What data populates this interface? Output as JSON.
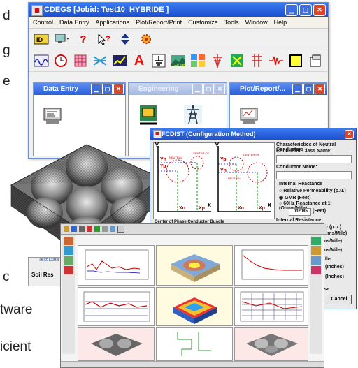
{
  "background_text": {
    "line1": "d",
    "line2": "g",
    "line3": "e",
    "line4": "c",
    "line5": "tware",
    "line6": "icient"
  },
  "main_window": {
    "title": "CDEGS [Jobid: Test10_HYBRIDE ]",
    "menu": [
      "Control",
      "Data Entry",
      "Applications",
      "Plot/Report/Print",
      "Customize",
      "Tools",
      "Window",
      "Help"
    ],
    "child_windows": {
      "data_entry": "Data Entry",
      "engineering": "Engineering",
      "plot": "Plot/Report/..."
    }
  },
  "fcdist_dialog": {
    "title": "FCDIST (Configuration Method)",
    "right_panel": {
      "heading": "Characteristics of Neutral Conductors",
      "class_name": "Conductor Class Name:",
      "conductor_name": "Conductor Name:",
      "internal_reactance": "Internal Reactance",
      "opt1": "Relative Permeability (p.u.)",
      "opt2": "GMR (Feet)",
      "opt3": "60Hz Reactance at 1' (Ohms/Mile)",
      "value": ".002085",
      "value_unit": "(Feet)",
      "internal_resistance": "Internal Resistance",
      "opt4": "Relative Resistivity (p.u.)",
      "opt5": "DC Resistance (Ohms/Mile)",
      "mile": "(Ohms/Mile)",
      "mile2": "(Ohms/Mile)",
      "bundle": "Bundle",
      "inches1": "(Inches)",
      "inches2": "(Inches)",
      "database": "tabase",
      "cancel": "Cancel"
    },
    "diagram_labels": {
      "y1": "Y",
      "y2": "Y",
      "x1": "X",
      "x2": "X",
      "yp1": "Yp",
      "yp2": "Yp",
      "yn1": "Yn",
      "yn2": "Yn",
      "xn1": "Xn",
      "xp1": "Xp",
      "xn2": "Xn",
      "xp2": "Xp",
      "center_bundle": "Center of Phase Conductor Bundle"
    }
  },
  "partial_labels": {
    "text_data": "Text Data",
    "soil_res": "Soil Res"
  },
  "colors": {
    "titlebar": "#1c4fcf",
    "close": "#d9462a",
    "plot_yellow": "#fff8c8"
  }
}
